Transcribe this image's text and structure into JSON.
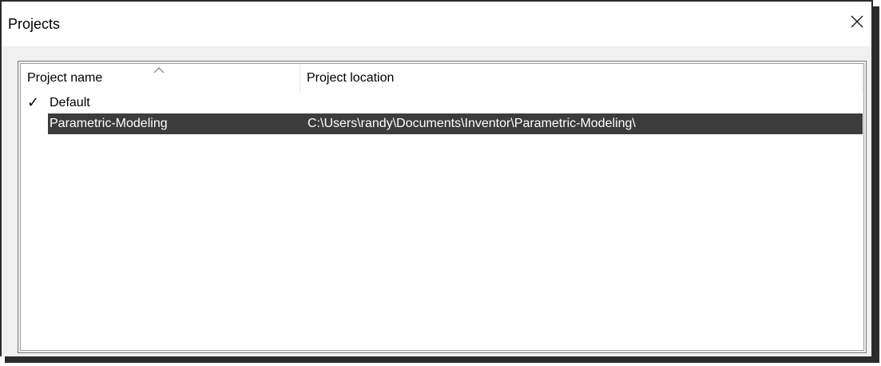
{
  "window": {
    "title": "Projects"
  },
  "list": {
    "columns": [
      {
        "label": "Project name"
      },
      {
        "label": "Project location"
      }
    ],
    "rows": [
      {
        "active_mark": "✓",
        "name": "Default",
        "location": ""
      },
      {
        "active_mark": "",
        "name": "Parametric-Modeling",
        "location": "C:\\Users\\randy\\Documents\\Inventor\\Parametric-Modeling\\"
      }
    ],
    "sort": {
      "column": "Project name",
      "direction": "ascending"
    },
    "selected_row": 1
  },
  "icons": {
    "close": "close-icon",
    "sort": "sort-ascending-icon",
    "active": "checkmark-icon"
  },
  "colors": {
    "selection_background": "#3c3c3c",
    "selection_text": "#ffffff",
    "window_background": "#f0f0f0",
    "titlebar_background": "#ffffff"
  }
}
